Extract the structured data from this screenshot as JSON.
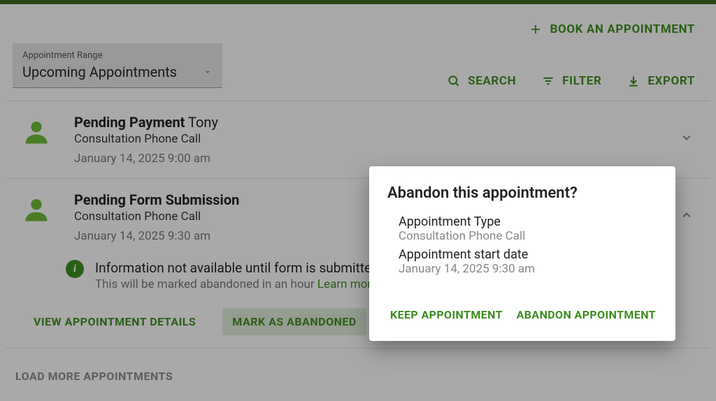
{
  "colors": {
    "accent": "#3d8c1e",
    "topbar": "#3d6c1e"
  },
  "header": {
    "book_label": "BOOK AN APPOINTMENT"
  },
  "toolbar": {
    "range_label": "Appointment Range",
    "range_value": "Upcoming Appointments",
    "search_label": "SEARCH",
    "filter_label": "FILTER",
    "export_label": "EXPORT"
  },
  "appointments": [
    {
      "status": "Pending Payment",
      "name": "Tony",
      "type": "Consultation Phone Call",
      "datetime": "January 14, 2025 9:00 am",
      "expanded": false
    },
    {
      "status": "Pending Form Submission",
      "name": "",
      "type": "Consultation Phone Call",
      "datetime": "January 14, 2025 9:30 am",
      "expanded": true,
      "info_title": "Information not available until form is submitted",
      "info_sub": "This will be marked abandoned in an hour",
      "learn_more": "Learn more",
      "action_details": "VIEW APPOINTMENT DETAILS",
      "action_abandon": "MARK AS ABANDONED"
    }
  ],
  "load_more": "LOAD MORE APPOINTMENTS",
  "dialog": {
    "title": "Abandon this appointment?",
    "type_label": "Appointment Type",
    "type_value": "Consultation Phone Call",
    "date_label": "Appointment start date",
    "date_value": "January 14, 2025 9:30 am",
    "keep_label": "KEEP APPOINTMENT",
    "abandon_label": "ABANDON APPOINTMENT"
  }
}
